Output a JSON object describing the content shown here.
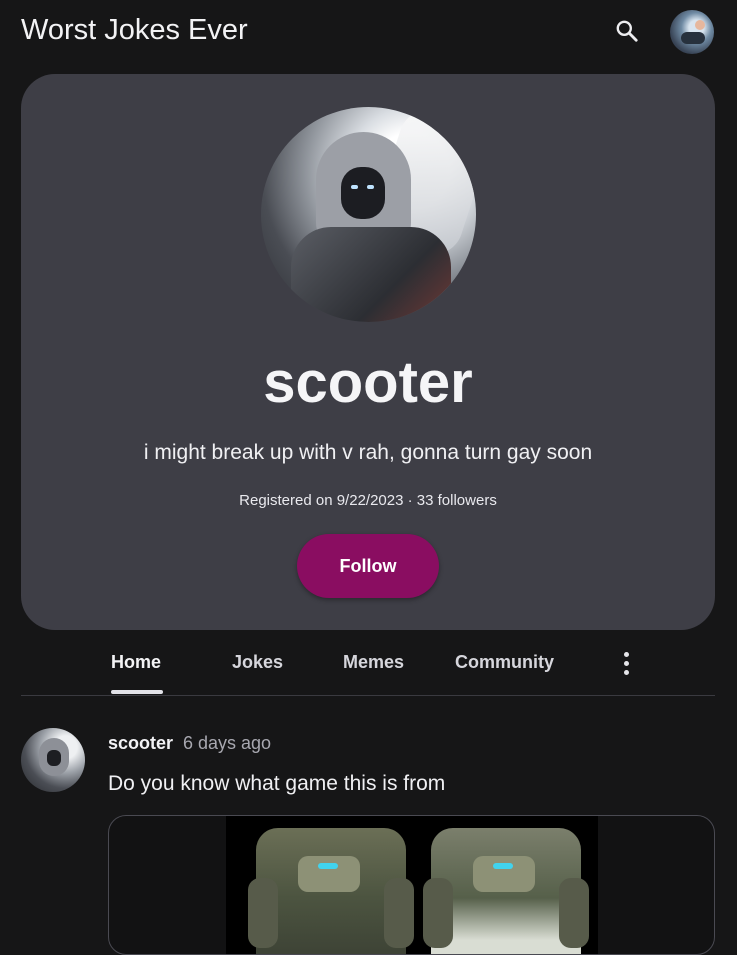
{
  "header": {
    "title": "Worst Jokes Ever",
    "search_icon": "search-icon",
    "avatar_icon": "user-avatar"
  },
  "profile": {
    "username": "scooter",
    "bio": "i might break up with v rah, gonna turn gay soon",
    "meta": "Registered on 9/22/2023 · 33 followers",
    "follow_label": "Follow",
    "accent_color": "#8a0d61"
  },
  "tabs": [
    {
      "label": "Home",
      "active": true
    },
    {
      "label": "Jokes",
      "active": false
    },
    {
      "label": "Memes",
      "active": false
    },
    {
      "label": "Community",
      "active": false
    }
  ],
  "post": {
    "author": "scooter",
    "time": "6 days ago",
    "text": "Do you know what game this is from"
  }
}
